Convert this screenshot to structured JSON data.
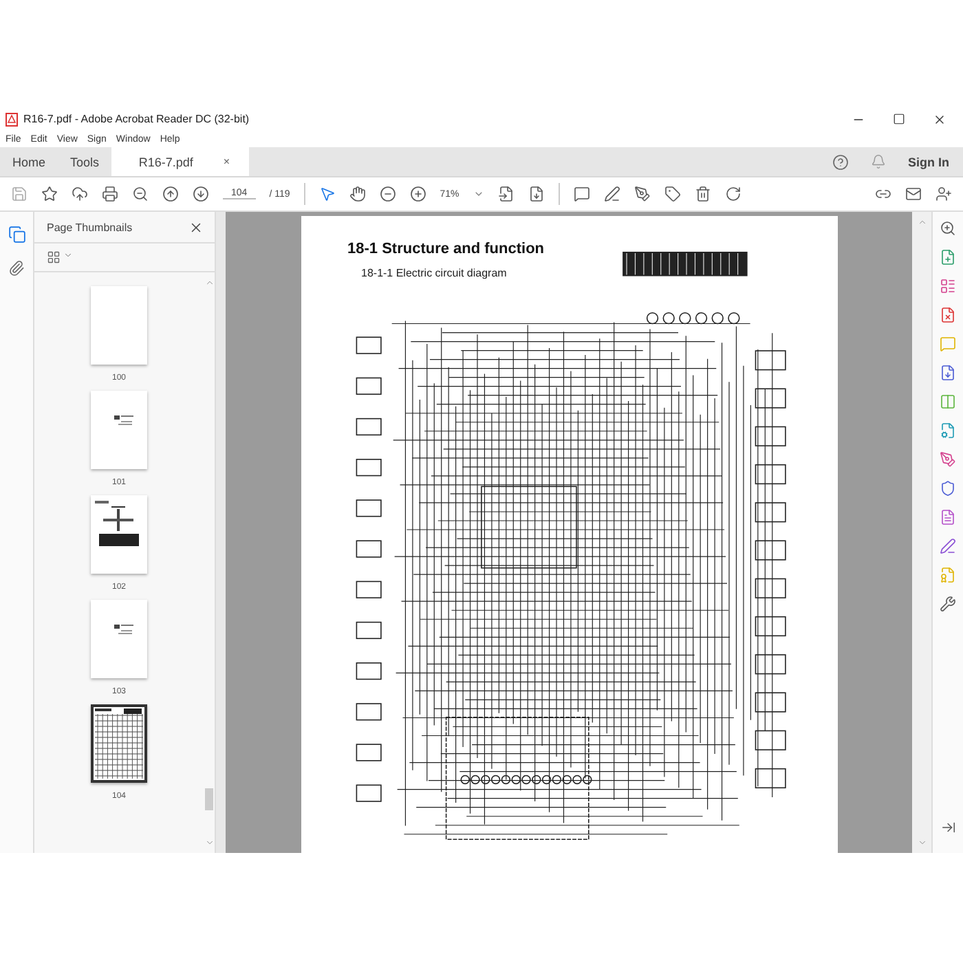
{
  "window": {
    "title": "R16-7.pdf - Adobe Acrobat Reader DC (32-bit)"
  },
  "menu": [
    "File",
    "Edit",
    "View",
    "Sign",
    "Window",
    "Help"
  ],
  "tabs": [
    {
      "label": "Home",
      "selected": false
    },
    {
      "label": "Tools",
      "selected": false
    },
    {
      "label": "R16-7.pdf",
      "selected": true,
      "close": "×"
    }
  ],
  "account": {
    "sign_in": "Sign In"
  },
  "toolbar": {
    "page": "104",
    "page_count": "/ 119",
    "zoom": "71%"
  },
  "sidebar": {
    "title": "Page Thumbnails",
    "thumbnails": [
      {
        "label": "100",
        "kind": "blank",
        "selected": false
      },
      {
        "label": "101",
        "kind": "text",
        "selected": false
      },
      {
        "label": "102",
        "kind": "figure",
        "selected": false
      },
      {
        "label": "103",
        "kind": "text",
        "selected": false
      },
      {
        "label": "104",
        "kind": "diagram",
        "selected": true
      }
    ]
  },
  "document": {
    "heading": "18-1 Structure and function",
    "subheading": "18-1-1 Electric circuit diagram"
  }
}
